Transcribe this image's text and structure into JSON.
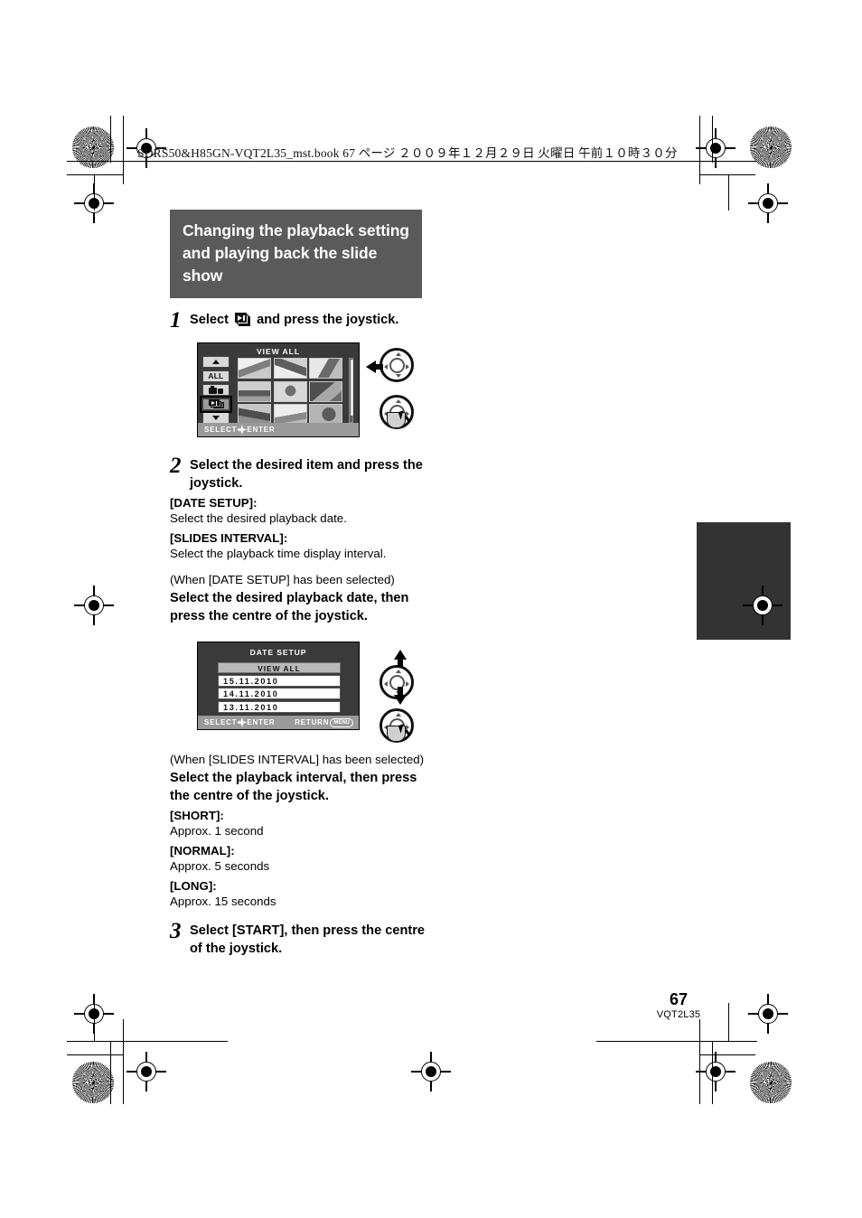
{
  "runhead": {
    "text": "SDRS50&H85GN-VQT2L35_mst.book   67 ページ   ２００９年１２月２９日   火曜日   午前１０時３０分"
  },
  "section": {
    "title": "Changing the playback setting and playing back the slide show"
  },
  "steps": {
    "one": {
      "number": "1",
      "text_before": "Select",
      "icon": "slideshow-icon",
      "text_after": "and press the joystick."
    },
    "two": {
      "number": "2",
      "text": "Select the desired item and press the joystick.",
      "items": [
        {
          "label": "[DATE SETUP]:",
          "desc": "Select the desired playback date."
        },
        {
          "label": "[SLIDES INTERVAL]:",
          "desc": "Select the playback time display interval."
        }
      ],
      "date_case": {
        "condition": "(When [DATE SETUP] has been selected)",
        "instruction": "Select the desired playback date, then press the centre of the joystick."
      },
      "interval_case": {
        "condition": "(When [SLIDES INTERVAL] has been selected)",
        "instruction": "Select the playback interval, then press the centre of the joystick.",
        "options": [
          {
            "label": "[SHORT]:",
            "desc": "Approx. 1 second"
          },
          {
            "label": "[NORMAL]:",
            "desc": "Approx. 5 seconds"
          },
          {
            "label": "[LONG]:",
            "desc": "Approx. 15 seconds"
          }
        ]
      }
    },
    "three": {
      "number": "3",
      "text": "Select [START], then press the centre of the joystick."
    }
  },
  "figure_viewall": {
    "screen_title": "VIEW ALL",
    "rail": [
      {
        "name": "scroll-up",
        "label": ""
      },
      {
        "name": "all",
        "label": "ALL"
      },
      {
        "name": "photo",
        "label": ""
      },
      {
        "name": "slideshow",
        "label": ""
      },
      {
        "name": "scroll-down",
        "label": ""
      }
    ],
    "footer": {
      "select": "SELECT",
      "enter": "ENTER"
    },
    "joystick_hint_left": "left",
    "joystick_hint_press": "press"
  },
  "figure_datesetup": {
    "screen_title": "DATE SETUP",
    "list_header": "VIEW ALL",
    "dates": [
      "15.11.2010",
      "14.11.2010",
      "13.11.2010"
    ],
    "footer": {
      "select": "SELECT",
      "enter": "ENTER",
      "return": "RETURN",
      "return_button": "MENU"
    },
    "joystick_hint_updown": "up-down",
    "joystick_hint_press": "press"
  },
  "footer": {
    "page_number": "67",
    "doc_code": "VQT2L35"
  },
  "colors": {
    "section_header_bg": "#5a5a5a",
    "thumb_tab": "#333333",
    "screen_bg": "#3a3a3a",
    "screen_footer_bg": "#9a9a9a"
  }
}
